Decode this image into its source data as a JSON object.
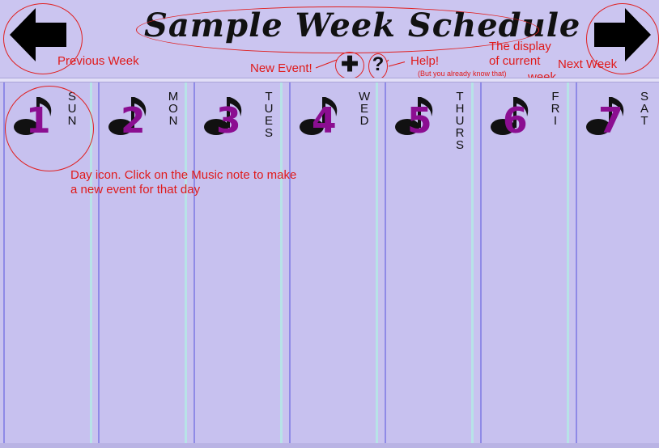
{
  "header": {
    "title": "Sample Week Schedule"
  },
  "nav": {
    "prev_icon": "arrow-left-icon",
    "next_icon": "arrow-right-icon"
  },
  "toolbar": {
    "new_event_glyph": "✚",
    "help_glyph": "?"
  },
  "annotations": {
    "prev": "Previous Week",
    "next": "Next Week",
    "new_event": "New Event!",
    "help": "Help!",
    "help_sub": "(But you already know that)",
    "display_1": "The display",
    "display_2": "of current",
    "display_3": "week",
    "day_icon_1": "Day icon. Click on the Music note to make",
    "day_icon_2": "a new event for that day"
  },
  "days": [
    {
      "num": "1",
      "name": "SUN"
    },
    {
      "num": "2",
      "name": "MON"
    },
    {
      "num": "3",
      "name": "TUES"
    },
    {
      "num": "4",
      "name": "WED"
    },
    {
      "num": "5",
      "name": "THURS"
    },
    {
      "num": "6",
      "name": "FRI"
    },
    {
      "num": "7",
      "name": "SAT"
    }
  ],
  "colors": {
    "background": "#c9c3ef",
    "annotation": "#e01a1a",
    "day_number": "#8b0e91"
  }
}
